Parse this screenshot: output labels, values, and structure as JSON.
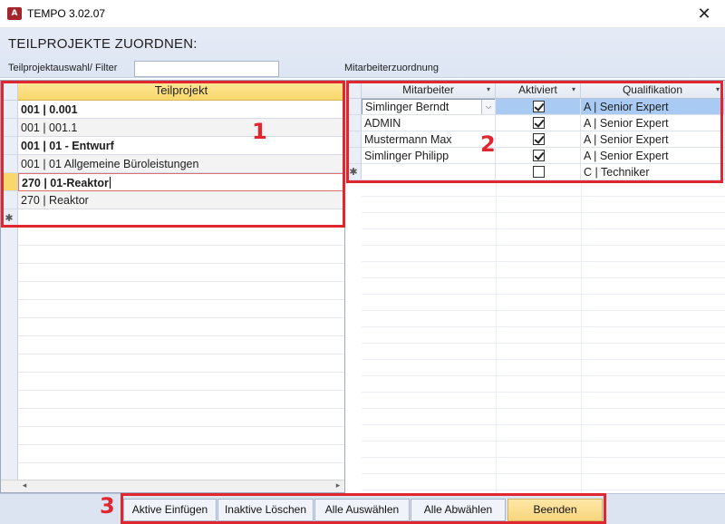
{
  "window": {
    "app_icon": "A",
    "title": "TEMPO 3.02.07",
    "close_glyph": "✕"
  },
  "header": {
    "page_title": "TEILPROJEKTE ZUORDNEN:",
    "filter_label": "Teilprojektauswahl/ Filter",
    "filter_value": "",
    "assignment_label": "Mitarbeiterzuordnung"
  },
  "left_table": {
    "column_header": "Teilprojekt",
    "rows": [
      {
        "text": "001 | 0.001"
      },
      {
        "text": "001 | 001.1"
      },
      {
        "text": "001 | 01 - Entwurf"
      },
      {
        "text": "001 | 01 Allgemeine Büroleistungen"
      },
      {
        "text": "270 | 01-Reaktor"
      },
      {
        "text": "270 | Reaktor"
      }
    ],
    "new_row_marker": "✱",
    "scroll_left_glyph": "◂",
    "scroll_right_glyph": "▸"
  },
  "right_table": {
    "columns": {
      "mitarbeiter": "Mitarbeiter",
      "aktiviert": "Aktiviert",
      "qualifikation": "Qualifikation"
    },
    "sort_glyph": "▾",
    "combo_glyph": "⌵",
    "rows": [
      {
        "mitarbeiter": "Simlinger Berndt",
        "aktiviert": true,
        "qualifikation": "A | Senior Expert"
      },
      {
        "mitarbeiter": "ADMIN",
        "aktiviert": true,
        "qualifikation": "A | Senior Expert"
      },
      {
        "mitarbeiter": "Mustermann Max",
        "aktiviert": true,
        "qualifikation": "A | Senior Expert"
      },
      {
        "mitarbeiter": "Simlinger Philipp",
        "aktiviert": true,
        "qualifikation": "A | Senior Expert"
      },
      {
        "mitarbeiter": "",
        "aktiviert": false,
        "qualifikation": "C | Techniker"
      }
    ],
    "new_row_marker": "✱"
  },
  "toolbar": {
    "aktive_einfuegen": "Aktive Einfügen",
    "inaktive_loeschen": "Inaktive Löschen",
    "alle_auswaehlen": "Alle Auswählen",
    "alle_abwaehlen": "Alle Abwählen",
    "beenden": "Beenden"
  },
  "annotations": {
    "one": "1",
    "two": "2",
    "three": "3",
    "color": "#e0262f"
  },
  "colors": {
    "accent_header": "#f9d76a",
    "selection": "#a9cbf3",
    "band": "#dde5f3"
  }
}
